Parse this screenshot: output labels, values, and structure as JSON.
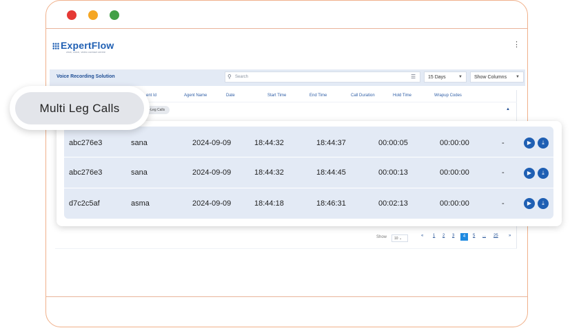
{
  "window": {
    "dots": [
      "red",
      "yellow",
      "green"
    ]
  },
  "app": {
    "logo": "ExpertFlow",
    "tagline": "chat, voice, video contact centre"
  },
  "toolbar": {
    "title": "Voice Recording Solution",
    "search_placeholder": "Search",
    "range": "15 Days",
    "columns_btn": "Show Columns"
  },
  "table": {
    "headers": [
      "ent Id",
      "Agent Name",
      "Date",
      "Start Time",
      "End Time",
      "Call Duration",
      "Hold Time",
      "Wrapup Codes"
    ],
    "chip": "lti-Leg Calls"
  },
  "callout": {
    "label": "Multi Leg Calls"
  },
  "rows": [
    {
      "id": "abc276e3",
      "agent": "sana",
      "date": "2024-09-09",
      "start": "18:44:32",
      "end": "18:44:37",
      "duration": "00:00:05",
      "hold": "00:00:00",
      "wrap": "-"
    },
    {
      "id": "abc276e3",
      "agent": "sana",
      "date": "2024-09-09",
      "start": "18:44:32",
      "end": "18:44:45",
      "duration": "00:00:13",
      "hold": "00:00:00",
      "wrap": "-"
    },
    {
      "id": "d7c2c5af",
      "agent": "asma",
      "date": "2024-09-09",
      "start": "18:44:18",
      "end": "18:46:31",
      "duration": "00:02:13",
      "hold": "00:00:00",
      "wrap": "-"
    }
  ],
  "pagination": {
    "show_label": "Show",
    "page_size": "10",
    "prev": "«",
    "pages": [
      "1",
      "2",
      "3",
      "4",
      "5",
      "...",
      "25"
    ],
    "active": "4",
    "next": "»"
  },
  "colors": {
    "accent": "#1f5fb3",
    "active_page": "#1f8ae0",
    "row_bg": "#e3eaf5"
  }
}
